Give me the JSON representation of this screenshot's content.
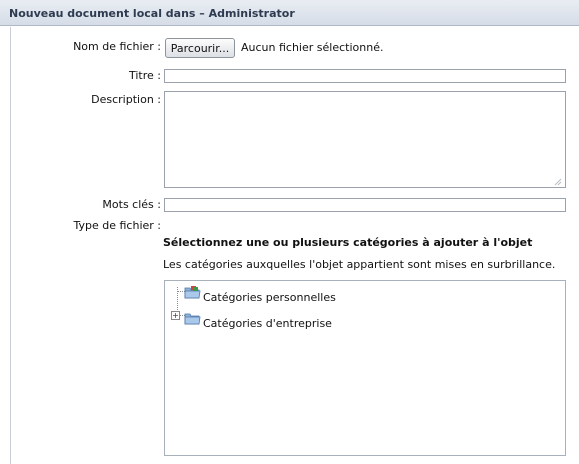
{
  "window": {
    "title": "Nouveau document local dans – Administrator"
  },
  "form": {
    "file_label": "Nom de fichier :",
    "browse_button": "Parcourir...",
    "file_status": "Aucun fichier sélectionné.",
    "title_label": "Titre :",
    "title_value": "",
    "description_label": "Description :",
    "description_value": "",
    "keywords_label": "Mots clés :",
    "keywords_value": "",
    "filetype_label": "Type de fichier :"
  },
  "categories": {
    "heading": "Sélectionnez une ou plusieurs catégories à ajouter à l'objet",
    "hint": "Les catégories auxquelles l'objet appartient sont mises en surbrillance.",
    "tree": [
      {
        "label": "Catégories personnelles",
        "icon": "folder-icon",
        "expandable": false
      },
      {
        "label": "Catégories d'entreprise",
        "icon": "folder-icon",
        "expandable": true
      }
    ]
  }
}
